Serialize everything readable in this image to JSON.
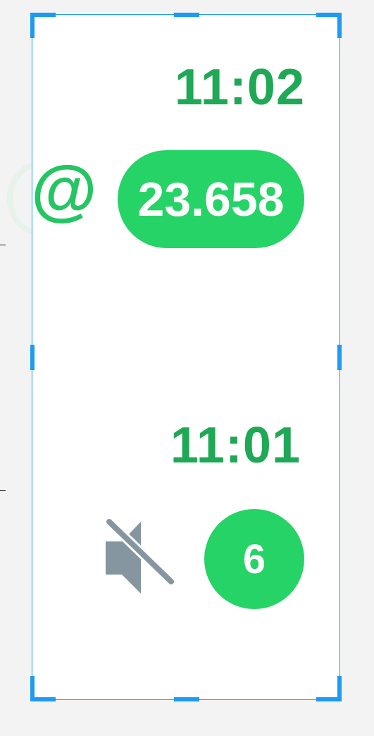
{
  "chats": [
    {
      "time": "11:02",
      "mention_icon": "at-sign-icon",
      "unread_count": "23.658"
    },
    {
      "time": "11:01",
      "muted_icon": "muted-speaker-icon",
      "unread_count": "6"
    }
  ],
  "colors": {
    "accent": "#25d366",
    "time": "#1fa855",
    "selection": "#1e9bf0",
    "muted_icon": "#8696a0"
  }
}
